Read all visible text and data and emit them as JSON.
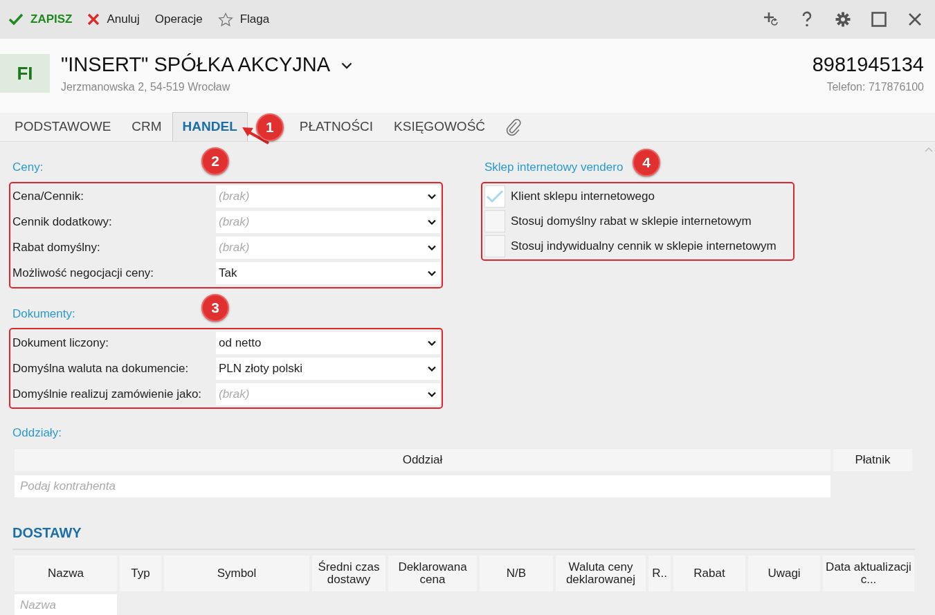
{
  "toolbar": {
    "actions": [
      {
        "kind": "save",
        "label": "ZAPISZ"
      },
      {
        "kind": "cancel",
        "label": "Anuluj"
      },
      {
        "kind": "plain",
        "label": "Operacje"
      },
      {
        "kind": "flag",
        "label": "Flaga"
      }
    ],
    "window_icons": [
      {
        "kind": "add"
      },
      {
        "kind": "help"
      },
      {
        "kind": "settings"
      },
      {
        "kind": "maximize"
      },
      {
        "kind": "close"
      }
    ]
  },
  "header": {
    "avatar": "FI",
    "name": "\"INSERT\" SPÓŁKA AKCYJNA",
    "address": "Jerzmanowska 2, 54-519 Wrocław",
    "tax_id": "8981945134",
    "phone": "Telefon: 717876100"
  },
  "tabs": {
    "badge": "1",
    "items": [
      {
        "kind": "text",
        "label": "PODSTAWOWE",
        "selected": false
      },
      {
        "kind": "text",
        "label": "CRM",
        "selected": false
      },
      {
        "kind": "text",
        "label": "HANDEL",
        "selected": true
      },
      {
        "kind": "text",
        "label": "PŁATNOŚCI",
        "selected": false
      },
      {
        "kind": "text",
        "label": "KSIĘGOWOŚĆ",
        "selected": false
      },
      {
        "kind": "attachment",
        "selected": false
      }
    ]
  },
  "prices": {
    "title": "Ceny:",
    "badge": "2",
    "highlighted": true,
    "fields": [
      {
        "label": "Cena/Cennik:",
        "placeholder": "(brak)"
      },
      {
        "label": "Cennik dodatkowy:",
        "placeholder": "(brak)"
      },
      {
        "label": "Rabat domyślny:",
        "placeholder": "(brak)"
      },
      {
        "label": "Możliwość negocjacji ceny:",
        "value": "Tak"
      }
    ]
  },
  "documents": {
    "title": "Dokumenty:",
    "badge": "3",
    "highlighted": true,
    "fields": [
      {
        "label": "Dokument liczony:",
        "value": "od netto"
      },
      {
        "label": "Domyślna waluta na dokumencie:",
        "value": "PLN złoty polski"
      },
      {
        "label": "Domyślnie realizuj zamówienie jako:",
        "placeholder": "(brak)"
      }
    ]
  },
  "shop": {
    "title": "Sklep internetowy vendero",
    "badge": "4",
    "highlighted": true,
    "options": [
      {
        "label": "Klient sklepu internetowego",
        "checked": true
      },
      {
        "label": "Stosuj domyślny rabat w sklepie internetowym",
        "checked": false
      },
      {
        "label": "Stosuj indywidualny cennik w sklepie internetowym",
        "checked": false
      }
    ]
  },
  "branches": {
    "title": "Oddziały:",
    "columns": [
      "Oddział",
      "Płatnik"
    ],
    "placeholder": "Podaj kontrahenta"
  },
  "deliveries": {
    "title": "DOSTAWY",
    "columns": [
      "Nazwa",
      "Typ",
      "Symbol",
      "Średni czas dostawy",
      "Deklarowana cena",
      "N/B",
      "Waluta ceny deklarowanej",
      "R..",
      "Rabat",
      "Uwagi",
      "Data aktualizacji c..."
    ],
    "placeholder": "Nazwa"
  }
}
